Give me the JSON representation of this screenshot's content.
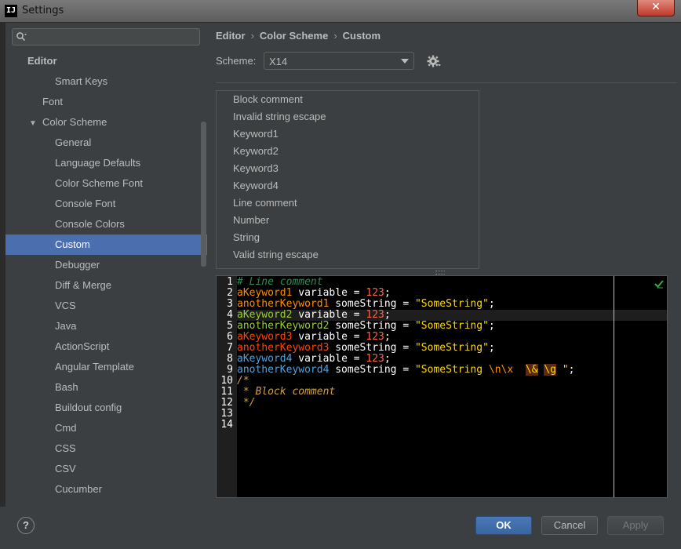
{
  "window": {
    "title": "Settings",
    "app_icon_text": "IJ",
    "close_glyph": "✕"
  },
  "search": {
    "placeholder": "",
    "value": ""
  },
  "tree": [
    {
      "label": "Editor",
      "level": 0,
      "header": true
    },
    {
      "label": "Smart Keys",
      "level": 2
    },
    {
      "label": "Font",
      "level": 1
    },
    {
      "label": "Color Scheme",
      "level": 1,
      "expanded": true
    },
    {
      "label": "General",
      "level": 2
    },
    {
      "label": "Language Defaults",
      "level": 2
    },
    {
      "label": "Color Scheme Font",
      "level": 2
    },
    {
      "label": "Console Font",
      "level": 2
    },
    {
      "label": "Console Colors",
      "level": 2
    },
    {
      "label": "Custom",
      "level": 2,
      "selected": true
    },
    {
      "label": "Debugger",
      "level": 2
    },
    {
      "label": "Diff & Merge",
      "level": 2
    },
    {
      "label": "VCS",
      "level": 2
    },
    {
      "label": "Java",
      "level": 2
    },
    {
      "label": "ActionScript",
      "level": 2
    },
    {
      "label": "Angular Template",
      "level": 2
    },
    {
      "label": "Bash",
      "level": 2
    },
    {
      "label": "Buildout config",
      "level": 2
    },
    {
      "label": "Cmd",
      "level": 2
    },
    {
      "label": "CSS",
      "level": 2
    },
    {
      "label": "CSV",
      "level": 2
    },
    {
      "label": "Cucumber",
      "level": 2
    }
  ],
  "breadcrumb": {
    "part1": "Editor",
    "part2": "Color Scheme",
    "part3": "Custom",
    "separator": "›"
  },
  "scheme": {
    "label": "Scheme:",
    "value": "X14"
  },
  "tokens": [
    "Block comment",
    "Invalid string escape",
    "Keyword1",
    "Keyword2",
    "Keyword3",
    "Keyword4",
    "Line comment",
    "Number",
    "String",
    "Valid string escape"
  ],
  "editor": {
    "current_line": 4,
    "lines": [
      [
        {
          "t": "# Line comment",
          "c": "lc"
        }
      ],
      [
        {
          "t": "aKeyword1",
          "c": "k1"
        },
        {
          "t": " variable = ",
          "c": "ident"
        },
        {
          "t": "123",
          "c": "num"
        },
        {
          "t": ";",
          "c": "ident"
        }
      ],
      [
        {
          "t": "anotherKeyword1",
          "c": "k1"
        },
        {
          "t": " someString = ",
          "c": "ident"
        },
        {
          "t": "\"SomeString\"",
          "c": "str"
        },
        {
          "t": ";",
          "c": "ident"
        }
      ],
      [
        {
          "t": "aKeyword2",
          "c": "k2"
        },
        {
          "t": " variable = ",
          "c": "ident"
        },
        {
          "t": "123",
          "c": "num"
        },
        {
          "t": ";",
          "c": "ident"
        }
      ],
      [
        {
          "t": "anotherKeyword2",
          "c": "k2"
        },
        {
          "t": " someString = ",
          "c": "ident"
        },
        {
          "t": "\"SomeString\"",
          "c": "str"
        },
        {
          "t": ";",
          "c": "ident"
        }
      ],
      [
        {
          "t": "aKeyword3",
          "c": "k3"
        },
        {
          "t": " variable = ",
          "c": "ident"
        },
        {
          "t": "123",
          "c": "num"
        },
        {
          "t": ";",
          "c": "ident"
        }
      ],
      [
        {
          "t": "anotherKeyword3",
          "c": "k3"
        },
        {
          "t": " someString = ",
          "c": "ident"
        },
        {
          "t": "\"SomeString\"",
          "c": "str"
        },
        {
          "t": ";",
          "c": "ident"
        }
      ],
      [
        {
          "t": "aKeyword4",
          "c": "k4"
        },
        {
          "t": " variable = ",
          "c": "ident"
        },
        {
          "t": "123",
          "c": "num"
        },
        {
          "t": ";",
          "c": "ident"
        }
      ],
      [
        {
          "t": "anotherKeyword4",
          "c": "k4"
        },
        {
          "t": " someString = ",
          "c": "ident"
        },
        {
          "t": "\"SomeString ",
          "c": "str"
        },
        {
          "t": "\\n\\x",
          "c": "esc"
        },
        {
          "t": "  ",
          "c": "str"
        },
        {
          "t": "\\&",
          "c": "bad"
        },
        {
          "t": " ",
          "c": "str"
        },
        {
          "t": "\\g",
          "c": "bad"
        },
        {
          "t": " \"",
          "c": "str"
        },
        {
          "t": ";",
          "c": "ident"
        }
      ],
      [
        {
          "t": "/*",
          "c": "bc"
        }
      ],
      [
        {
          "t": " * Block comment",
          "c": "bc"
        }
      ],
      [
        {
          "t": " */",
          "c": "bc"
        }
      ],
      [],
      []
    ]
  },
  "buttons": {
    "help": "?",
    "ok": "OK",
    "cancel": "Cancel",
    "apply": "Apply"
  },
  "colors": {
    "selection": "#4b6eaf",
    "background": "#3c3f41",
    "editor_bg": "#000000"
  },
  "icons": [
    "search-icon",
    "gear-icon",
    "check-icon",
    "chevron-down-icon",
    "help-icon",
    "close-icon"
  ]
}
